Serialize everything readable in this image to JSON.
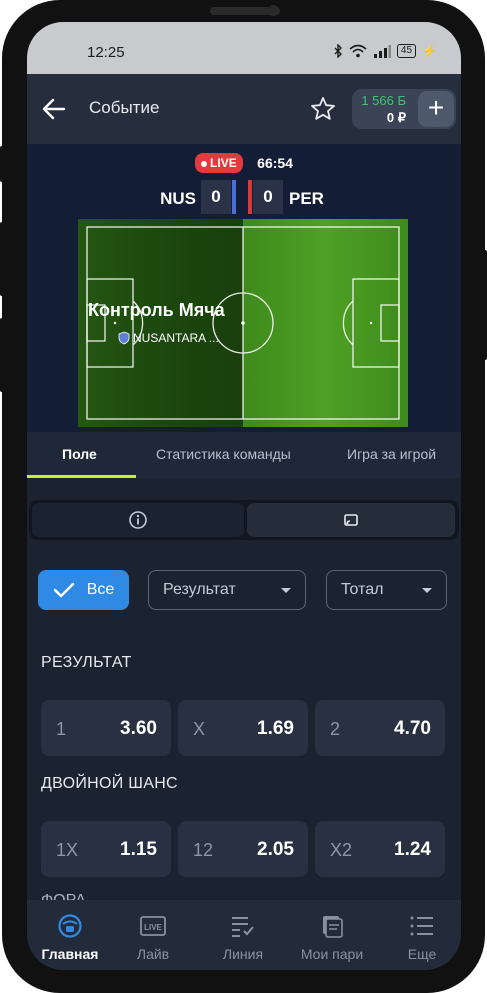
{
  "status_bar": {
    "time": "12:25",
    "battery": "45",
    "icons": [
      "bluetooth-icon",
      "wifi-icon",
      "signal-icon",
      "battery-icon",
      "charging-icon"
    ]
  },
  "appbar": {
    "title": "Событие",
    "balance_primary": "1 566 Б",
    "balance_secondary": "0 ₽",
    "add_label": "+"
  },
  "match": {
    "live_label": "LIVE",
    "clock": "66:54",
    "home_team": "NUS",
    "away_team": "PER",
    "home_score": "0",
    "away_score": "0",
    "possession_text": "Контроль Мяча",
    "possession_team": "NUSANTARA ..."
  },
  "tabs": {
    "field": "Поле",
    "stats": "Статистика команды",
    "pbp": "Игра за игрой"
  },
  "filters": {
    "all": "Все",
    "result": "Результат",
    "total": "Тотал"
  },
  "markets": {
    "result": {
      "title": "РЕЗУЛЬТАТ",
      "odds": [
        {
          "label": "1",
          "value": "3.60"
        },
        {
          "label": "X",
          "value": "1.69"
        },
        {
          "label": "2",
          "value": "4.70"
        }
      ]
    },
    "double_chance": {
      "title": "ДВОЙНОЙ ШАНС",
      "odds": [
        {
          "label": "1X",
          "value": "1.15"
        },
        {
          "label": "12",
          "value": "2.05"
        },
        {
          "label": "X2",
          "value": "1.24"
        }
      ]
    },
    "next_title": "ФОРА"
  },
  "nav": {
    "home": "Главная",
    "live": "Лайв",
    "line": "Линия",
    "bets": "Мои пари",
    "more": "Еще"
  },
  "colors": {
    "accent_blue": "#2f8ae6",
    "live_red": "#e43a3f",
    "tab_underline": "#c6ee3c",
    "balance_green": "#41c173"
  }
}
